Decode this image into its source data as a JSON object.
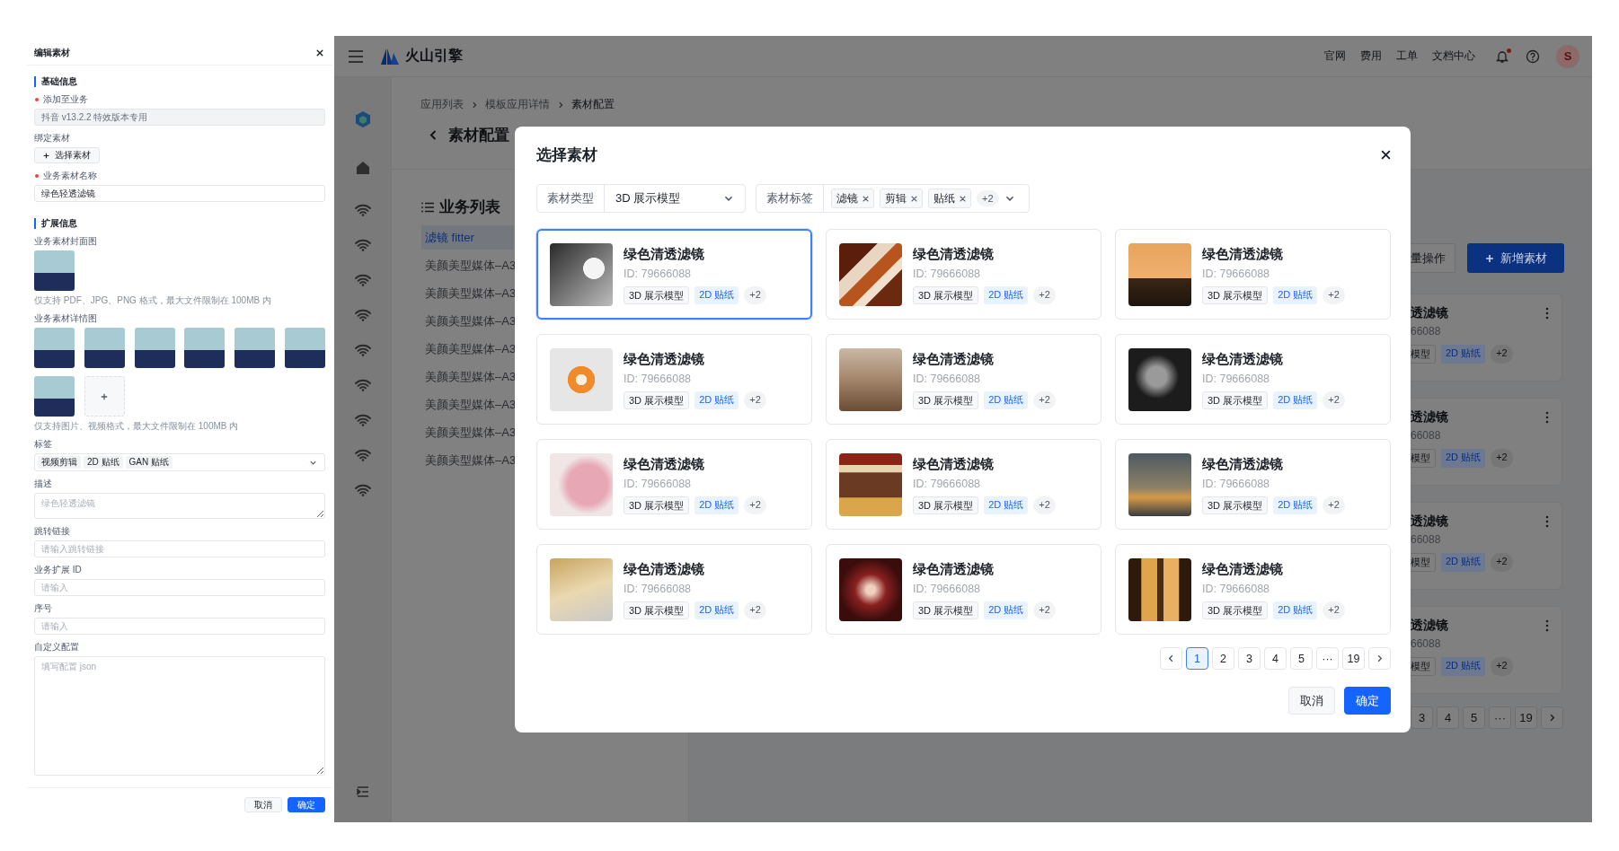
{
  "edit_drawer": {
    "title": "编辑素材",
    "items": [
      {
        "kind": "section",
        "title": "基础信息"
      },
      {
        "kind": "input",
        "label": "添加至业务",
        "required": true,
        "value": "抖音 v13.2.2 特效版本专用",
        "disabled": true
      },
      {
        "kind": "button",
        "label": "绑定素材",
        "button": "选择素材"
      },
      {
        "kind": "input",
        "label": "业务素材名称",
        "required": true,
        "value": "绿色轻透滤镜",
        "disabled": false
      },
      {
        "kind": "section",
        "title": "扩展信息"
      },
      {
        "kind": "images",
        "label": "业务素材封面图",
        "images": [
          {
            "kind": "illustration"
          }
        ],
        "hint": "仅支持 PDF、JPG、PNG 格式，最大文件限制在 100MB 内"
      },
      {
        "kind": "images",
        "label": "业务素材详情图",
        "images": [
          {
            "kind": "illustration"
          },
          {
            "kind": "illustration"
          },
          {
            "kind": "illustration"
          },
          {
            "kind": "illustration"
          },
          {
            "kind": "illustration"
          },
          {
            "kind": "illustration"
          },
          {
            "kind": "illustration"
          }
        ],
        "add_tile": true,
        "hint": "仅支持图片、视频格式，最大文件限制在 100MB 内"
      },
      {
        "kind": "tags",
        "label": "标签",
        "tags": [
          "视频剪辑",
          "2D 贴纸",
          "GAN 贴纸"
        ]
      },
      {
        "kind": "textarea",
        "label": "描述",
        "placeholder": "绿色轻透滤镜"
      },
      {
        "kind": "input",
        "label": "跳转链接",
        "placeholder": "请输入跳转链接",
        "disabled": false
      },
      {
        "kind": "input",
        "label": "业务扩展 ID",
        "placeholder": "请输入",
        "disabled": false
      },
      {
        "kind": "input",
        "label": "序号",
        "placeholder": "请输入",
        "disabled": false
      },
      {
        "kind": "textarea_large",
        "label": "自定义配置",
        "placeholder": "填写配置 json"
      }
    ],
    "buttons": [
      {
        "label": "取消",
        "primary": false
      },
      {
        "label": "确定",
        "primary": true
      }
    ]
  },
  "top_bar": {
    "brand": "火山引擎",
    "links": [
      "官网",
      "费用",
      "工单",
      "文档中心"
    ],
    "has_notification": true,
    "avatar": "S"
  },
  "rail": {
    "items": [
      {
        "kind": "logo"
      },
      {
        "kind": "home"
      },
      {
        "kind": "wifi"
      },
      {
        "kind": "wifi"
      },
      {
        "kind": "wifi"
      },
      {
        "kind": "wifi"
      },
      {
        "kind": "wifi"
      },
      {
        "kind": "wifi"
      },
      {
        "kind": "wifi"
      },
      {
        "kind": "wifi"
      },
      {
        "kind": "wifi"
      }
    ]
  },
  "breadcrumb": [
    "应用列表",
    "模板应用详情",
    "素材配置"
  ],
  "page_title": "素材配置",
  "business_list": {
    "title": "业务列表",
    "items": [
      {
        "label": "滤镜 fitter",
        "selected": true
      },
      {
        "label": "美颜美型媒体–A3",
        "selected": false
      },
      {
        "label": "美颜美型媒体–A3",
        "selected": false
      },
      {
        "label": "美颜美型媒体–A3",
        "selected": false
      },
      {
        "label": "美颜美型媒体–A3",
        "selected": false
      },
      {
        "label": "美颜美型媒体–A3",
        "selected": false
      },
      {
        "label": "美颜美型媒体–A3",
        "selected": false
      },
      {
        "label": "美颜美型媒体–A3",
        "selected": false
      },
      {
        "label": "美颜美型媒体–A3",
        "selected": false
      }
    ]
  },
  "right_panel": {
    "buttons": [
      {
        "label": "量操作",
        "primary": false
      },
      {
        "label": "新增素材",
        "primary": true
      }
    ],
    "cards": [
      {
        "title": "透滤镜",
        "id": "66088",
        "tags": [
          {
            "text": "模型",
            "kind": "type"
          },
          {
            "text": "2D 贴纸",
            "kind": "label"
          },
          {
            "text": "+2",
            "kind": "more"
          }
        ]
      },
      {
        "title": "透滤镜",
        "id": "66088",
        "tags": [
          {
            "text": "模型",
            "kind": "type"
          },
          {
            "text": "2D 贴纸",
            "kind": "label"
          },
          {
            "text": "+2",
            "kind": "more"
          }
        ]
      },
      {
        "title": "透滤镜",
        "id": "66088",
        "tags": [
          {
            "text": "模型",
            "kind": "type"
          },
          {
            "text": "2D 贴纸",
            "kind": "label"
          },
          {
            "text": "+2",
            "kind": "more"
          }
        ]
      },
      {
        "title": "透滤镜",
        "id": "66088",
        "tags": [
          {
            "text": "模型",
            "kind": "type"
          },
          {
            "text": "2D 贴纸",
            "kind": "label"
          },
          {
            "text": "+2",
            "kind": "more"
          }
        ]
      }
    ],
    "pages": [
      "3",
      "4",
      "5",
      "···",
      "19"
    ]
  },
  "modal": {
    "title": "选择素材",
    "filters": [
      {
        "kind": "select",
        "label": "素材类型",
        "value": "3D 展示模型"
      },
      {
        "kind": "tags",
        "label": "素材标签",
        "tags": [
          "滤镜",
          "剪辑",
          "贴纸"
        ],
        "more": "+2"
      }
    ],
    "cards": [
      {
        "title": "绿色清透滤镜",
        "id": "ID: 79666088",
        "selected": true,
        "tags": [
          {
            "text": "3D 展示模型",
            "kind": "type"
          },
          {
            "text": "2D 贴纸",
            "kind": "label"
          },
          {
            "text": "+2",
            "kind": "more"
          }
        ]
      },
      {
        "title": "绿色清透滤镜",
        "id": "ID: 79666088",
        "selected": false,
        "tags": [
          {
            "text": "3D 展示模型",
            "kind": "type"
          },
          {
            "text": "2D 贴纸",
            "kind": "label"
          },
          {
            "text": "+2",
            "kind": "more"
          }
        ]
      },
      {
        "title": "绿色清透滤镜",
        "id": "ID: 79666088",
        "selected": false,
        "tags": [
          {
            "text": "3D 展示模型",
            "kind": "type"
          },
          {
            "text": "2D 贴纸",
            "kind": "label"
          },
          {
            "text": "+2",
            "kind": "more"
          }
        ]
      },
      {
        "title": "绿色清透滤镜",
        "id": "ID: 79666088",
        "selected": false,
        "tags": [
          {
            "text": "3D 展示模型",
            "kind": "type"
          },
          {
            "text": "2D 贴纸",
            "kind": "label"
          },
          {
            "text": "+2",
            "kind": "more"
          }
        ]
      },
      {
        "title": "绿色清透滤镜",
        "id": "ID: 79666088",
        "selected": false,
        "tags": [
          {
            "text": "3D 展示模型",
            "kind": "type"
          },
          {
            "text": "2D 贴纸",
            "kind": "label"
          },
          {
            "text": "+2",
            "kind": "more"
          }
        ]
      },
      {
        "title": "绿色清透滤镜",
        "id": "ID: 79666088",
        "selected": false,
        "tags": [
          {
            "text": "3D 展示模型",
            "kind": "type"
          },
          {
            "text": "2D 贴纸",
            "kind": "label"
          },
          {
            "text": "+2",
            "kind": "more"
          }
        ]
      },
      {
        "title": "绿色清透滤镜",
        "id": "ID: 79666088",
        "selected": false,
        "tags": [
          {
            "text": "3D 展示模型",
            "kind": "type"
          },
          {
            "text": "2D 贴纸",
            "kind": "label"
          },
          {
            "text": "+2",
            "kind": "more"
          }
        ]
      },
      {
        "title": "绿色清透滤镜",
        "id": "ID: 79666088",
        "selected": false,
        "tags": [
          {
            "text": "3D 展示模型",
            "kind": "type"
          },
          {
            "text": "2D 贴纸",
            "kind": "label"
          },
          {
            "text": "+2",
            "kind": "more"
          }
        ]
      },
      {
        "title": "绿色清透滤镜",
        "id": "ID: 79666088",
        "selected": false,
        "tags": [
          {
            "text": "3D 展示模型",
            "kind": "type"
          },
          {
            "text": "2D 贴纸",
            "kind": "label"
          },
          {
            "text": "+2",
            "kind": "more"
          }
        ]
      },
      {
        "title": "绿色清透滤镜",
        "id": "ID: 79666088",
        "selected": false,
        "tags": [
          {
            "text": "3D 展示模型",
            "kind": "type"
          },
          {
            "text": "2D 贴纸",
            "kind": "label"
          },
          {
            "text": "+2",
            "kind": "more"
          }
        ]
      },
      {
        "title": "绿色清透滤镜",
        "id": "ID: 79666088",
        "selected": false,
        "tags": [
          {
            "text": "3D 展示模型",
            "kind": "type"
          },
          {
            "text": "2D 贴纸",
            "kind": "label"
          },
          {
            "text": "+2",
            "kind": "more"
          }
        ]
      },
      {
        "title": "绿色清透滤镜",
        "id": "ID: 79666088",
        "selected": false,
        "tags": [
          {
            "text": "3D 展示模型",
            "kind": "type"
          },
          {
            "text": "2D 贴纸",
            "kind": "label"
          },
          {
            "text": "+2",
            "kind": "more"
          }
        ]
      }
    ],
    "pagination": [
      {
        "label": "1",
        "selected": true
      },
      {
        "label": "2",
        "selected": false
      },
      {
        "label": "3",
        "selected": false
      },
      {
        "label": "4",
        "selected": false
      },
      {
        "label": "5",
        "selected": false
      },
      {
        "label": "···",
        "selected": false
      },
      {
        "label": "19",
        "selected": false
      }
    ],
    "buttons": [
      {
        "label": "取消",
        "primary": false
      },
      {
        "label": "确定",
        "primary": true
      }
    ]
  }
}
